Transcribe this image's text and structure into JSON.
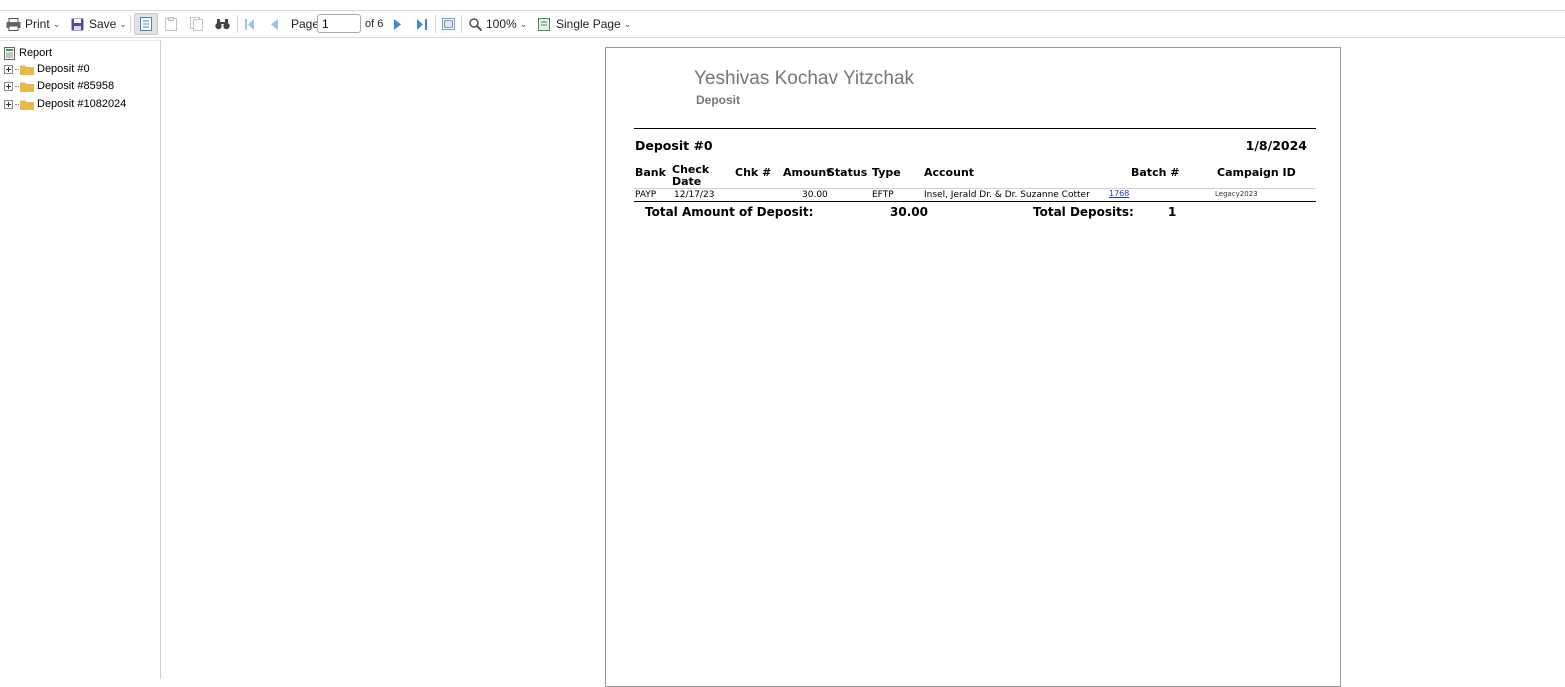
{
  "toolbar": {
    "print_label": "Print",
    "save_label": "Save",
    "page_label": "Page",
    "page_value": "1",
    "of_label": "of 6",
    "zoom_label": "100%",
    "view_mode_label": "Single Page"
  },
  "sidebar": {
    "root_label": "Report",
    "items": [
      {
        "label": "Deposit #0"
      },
      {
        "label": "Deposit #85958"
      },
      {
        "label": "Deposit #1082024"
      }
    ]
  },
  "report": {
    "organization": "Yeshivas Kochav Yitzchak",
    "subtitle": "Deposit",
    "deposit_title": "Deposit #0",
    "deposit_date": "1/8/2024",
    "columns": {
      "bank": "Bank",
      "check_date_1": "Check",
      "check_date_2": "Date",
      "chk_no": "Chk #",
      "amount": "Amount",
      "status": "Status",
      "type": "Type",
      "account": "Account",
      "batch": "Batch #",
      "campaign": "Campaign ID"
    },
    "row": {
      "bank": "PAYP",
      "check_date": "12/17/23",
      "amount": "30.00",
      "type": "EFTP",
      "account": "Insel, Jerald Dr. & Dr. Suzanne Cotter",
      "batch": "1768",
      "campaign": "Legacy2023"
    },
    "totals": {
      "amount_label": "Total Amount of Deposit:",
      "amount_value": "30.00",
      "count_label": "Total Deposits:",
      "count_value": "1"
    }
  },
  "colors": {
    "accent": "#3d8ad8",
    "link": "#1a3fbf",
    "folder": "#e8b84a"
  }
}
